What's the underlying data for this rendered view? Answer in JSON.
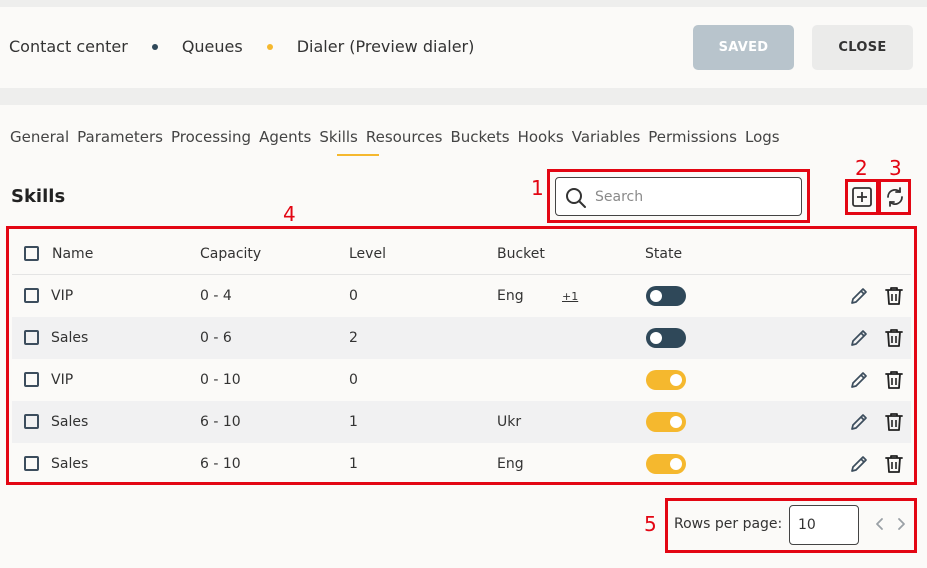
{
  "breadcrumb": {
    "items": [
      "Contact center",
      "Queues",
      "Dialer (Preview dialer)"
    ],
    "dot_colors": [
      "#2f4859",
      "#f5b82e"
    ]
  },
  "header": {
    "saved_label": "SAVED",
    "close_label": "CLOSE"
  },
  "tabs": [
    "General",
    "Parameters",
    "Processing",
    "Agents",
    "Skills",
    "Resources",
    "Buckets",
    "Hooks",
    "Variables",
    "Permissions",
    "Logs"
  ],
  "active_tab": "Skills",
  "section": {
    "title": "Skills"
  },
  "search": {
    "placeholder": "Search",
    "value": ""
  },
  "annotations": [
    "1",
    "2",
    "3",
    "4",
    "5"
  ],
  "table": {
    "columns": [
      "Name",
      "Capacity",
      "Level",
      "Bucket",
      "State"
    ],
    "rows": [
      {
        "name": "VIP",
        "capacity": "0 - 4",
        "level": "0",
        "bucket": "Eng",
        "bucket_extra": "+1",
        "state": false
      },
      {
        "name": "Sales",
        "capacity": "0 - 6",
        "level": "2",
        "bucket": "",
        "bucket_extra": "",
        "state": false
      },
      {
        "name": "VIP",
        "capacity": "0 - 10",
        "level": "0",
        "bucket": "",
        "bucket_extra": "",
        "state": true
      },
      {
        "name": "Sales",
        "capacity": "6 - 10",
        "level": "1",
        "bucket": "Ukr",
        "bucket_extra": "",
        "state": true
      },
      {
        "name": "Sales",
        "capacity": "6 - 10",
        "level": "1",
        "bucket": "Eng",
        "bucket_extra": "",
        "state": true
      }
    ]
  },
  "pagination": {
    "rows_per_page_label": "Rows per page:",
    "rows_per_page_value": "10"
  },
  "colors": {
    "accent": "#f5b82e",
    "toggle_off": "#2f4859",
    "annotation": "#e30613"
  },
  "icons": [
    "search-icon",
    "add-icon",
    "refresh-icon",
    "edit-icon",
    "delete-icon",
    "chevron-left-icon",
    "chevron-right-icon"
  ]
}
